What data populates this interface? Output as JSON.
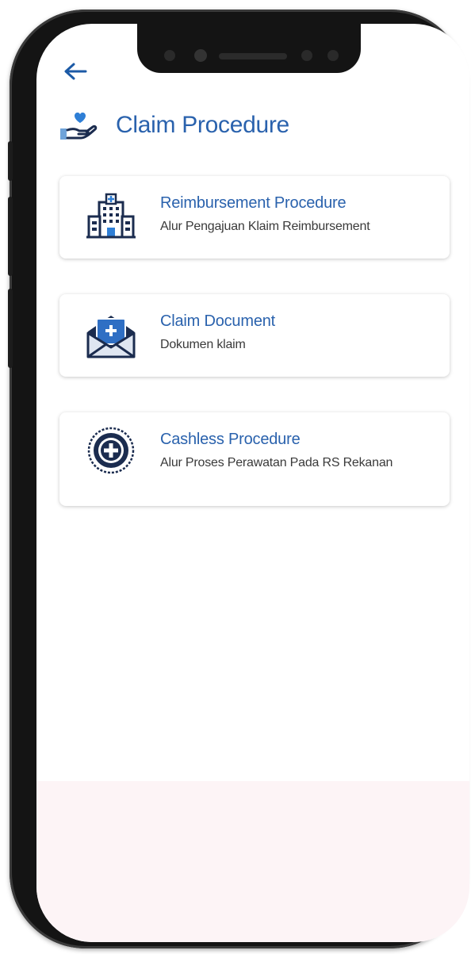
{
  "header": {
    "back_icon": "arrow-left-icon",
    "title": "Claim Procedure",
    "title_icon": "hand-heart-icon"
  },
  "menu": [
    {
      "title": "Reimbursement Procedure",
      "subtitle": "Alur Pengajuan Klaim Reimbursement",
      "icon": "hospital-building-icon"
    },
    {
      "title": "Claim Document",
      "subtitle": "Dokumen klaim",
      "icon": "envelope-document-icon"
    },
    {
      "title": "Cashless Procedure",
      "subtitle": "Alur Proses Perawatan Pada RS Rekanan",
      "icon": "plus-circle-icon"
    }
  ],
  "colors": {
    "accent": "#2a62ad",
    "dark_navy": "#1b2c4f",
    "bottom_tint": "#fdf4f6"
  }
}
